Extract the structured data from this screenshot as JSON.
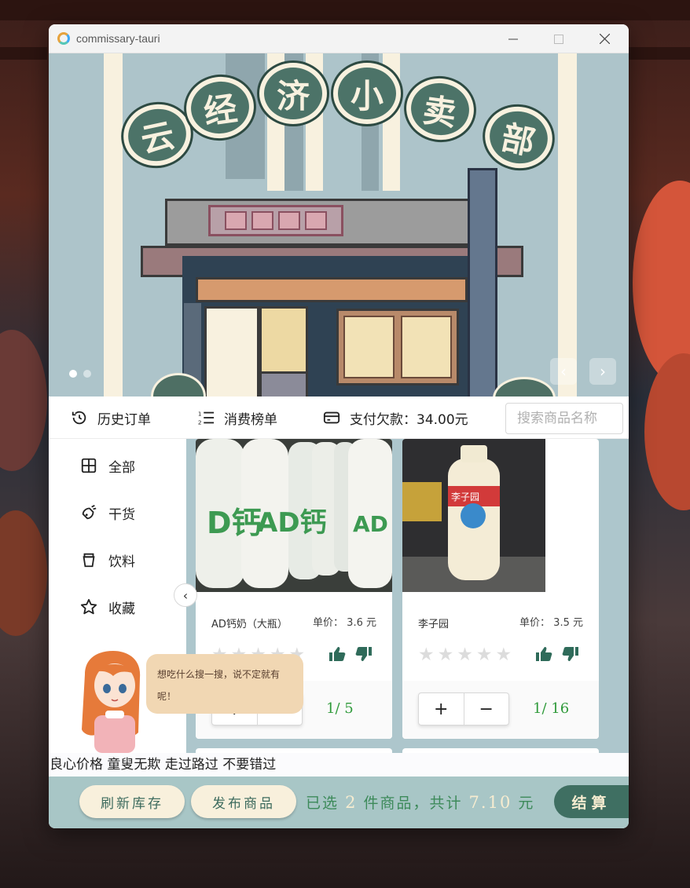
{
  "window": {
    "title": "commissary-tauri"
  },
  "banner": {
    "title_chars": [
      "云",
      "经",
      "济",
      "小",
      "卖",
      "部"
    ],
    "prev_icon": "chevron-left-icon",
    "next_icon": "chevron-right-icon"
  },
  "toolbar": {
    "history_label": "历史订单",
    "ranking_label": "消费榜单",
    "debt_label": "支付欠款：34.00元",
    "search_placeholder": "搜索商品名称"
  },
  "sidebar": {
    "items": [
      {
        "label": "全部",
        "icon": "grid-icon"
      },
      {
        "label": "干货",
        "icon": "food-icon"
      },
      {
        "label": "饮料",
        "icon": "cup-icon"
      },
      {
        "label": "收藏",
        "icon": "star-icon"
      }
    ]
  },
  "mascot": {
    "speech": "想吃什么搜一搜，说不定就有呢！"
  },
  "products": [
    {
      "name": "AD钙奶（大瓶）",
      "price": "单价：  3.6 元",
      "quantity": "1/ 5",
      "rating": 0
    },
    {
      "name": "李子园",
      "price": "单价：  3.5 元",
      "quantity": "1/ 16",
      "rating": 0
    }
  ],
  "stepper": {
    "plus": "+",
    "minus": "−"
  },
  "marquee": "良心价格 童叟无欺 走过路过 不要错过",
  "footer": {
    "refresh_label": "刷新库存",
    "publish_label": "发布商品",
    "summary_prefix": "已选",
    "summary_count": "2",
    "summary_middle": "件商品，共计",
    "summary_total": "7.10",
    "summary_unit": "元",
    "checkout_label": "结算"
  },
  "colors": {
    "accent": "#3f6f62",
    "banner_bg": "#adc4ca",
    "footer_bg": "#a8c6c6",
    "qty_green": "#2f9a3a"
  }
}
